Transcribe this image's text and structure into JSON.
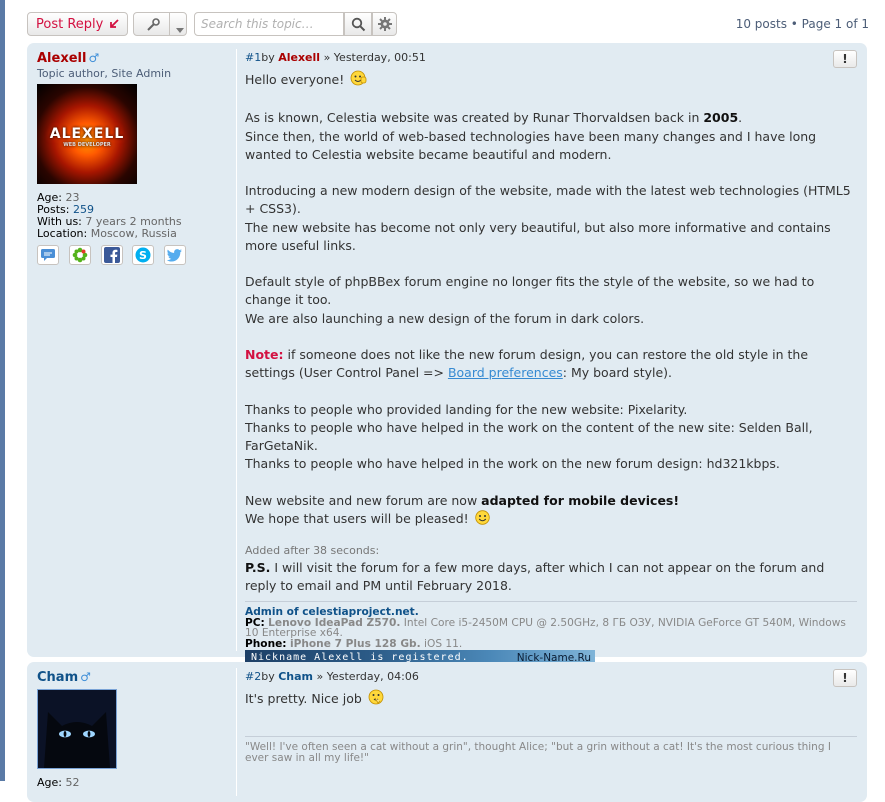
{
  "toolbar": {
    "post_reply_label": "Post Reply",
    "search_placeholder": "Search this topic…",
    "pagination_text": "10 posts • Page ",
    "pagination_current": "1",
    "pagination_of": " of ",
    "pagination_total": "1"
  },
  "posts": [
    {
      "author": "Alexell",
      "gender_symbol": "♂",
      "rank": "Topic author, Site Admin",
      "avatar_logo": "ALEXELL",
      "avatar_sub": "WEB DEVELOPER",
      "age_label": "Age:",
      "age": "23",
      "posts_label": "Posts:",
      "posts": "259",
      "with_us_label": "With us:",
      "with_us": "7 years 2 months",
      "location_label": "Location:",
      "location": "Moscow, Russia",
      "number": "#1",
      "by": "by",
      "date": "» Yesterday, 00:51",
      "report": "!",
      "p1": "Hello everyone!",
      "p2a": "As is known, Celestia website was created by Runar Thorvaldsen back in ",
      "p2b": "2005",
      "p2c": ".",
      "p3": "Since then, the world of web-based technologies have been many changes and I have long wanted to Celestia website became beautiful and modern.",
      "p4": "Introducing a new modern design of the website, made with the latest web technologies (HTML5 + CSS3).",
      "p5": "The new website has become not only very beautiful, but also more informative and contains more useful links.",
      "p6": "Default style of phpBBex forum engine no longer fits the style of the website, so we had to change it too.",
      "p7": "We are also launching a new design of the forum in dark colors.",
      "note_label": "Note:",
      "note_text": " if someone does not like the new forum design, you can restore the old style in the settings (User Control Panel => ",
      "note_link": "Board preferences",
      "note_tail": ": My board style).",
      "p8": "Thanks to people who provided landing for the new website: Pixelarity.",
      "p9": "Thanks to people who have helped in the work on the content of the new site: Selden Ball, FarGetaNik.",
      "p10": "Thanks to people who have helped in the work on the new forum design: hd321kbps.",
      "p11a": "New website and new forum are now ",
      "p11b": "adapted for mobile devices!",
      "p12": "We hope that users will be pleased!",
      "added": "Added after 38 seconds:",
      "ps_label": "P.S.",
      "ps_text": " I will visit the forum for a few more days, after which I can not appear on the forum and reply to email and PM until February 2018.",
      "sig_admin": "Admin of celestiaproject.net.",
      "sig_pc_label": "PC:",
      "sig_pc_model": "Lenovo IdeaPad Z570.",
      "sig_pc_spec": " Intel Core i5-2450M CPU @ 2.50GHz, 8 ГБ ОЗУ, NVIDIA GeForce GT 540M, Windows 10 Enterprise x64.",
      "sig_phone_label": "Phone:",
      "sig_phone_model": "iPhone 7 Plus 128 Gb.",
      "sig_phone_os": " iOS 11.",
      "nick_left": "Nickname Alexell is registered.",
      "nick_right": "Nick-Name.Ru"
    },
    {
      "author": "Cham",
      "gender_symbol": "♂",
      "age_label": "Age:",
      "age": "52",
      "number": "#2",
      "by": "by",
      "date": "» Yesterday, 04:06",
      "report": "!",
      "text": "It's pretty. Nice job",
      "signature": "\"Well! I've often seen a cat without a grin\", thought Alice; \"but a grin without a cat! It's the most curious thing I ever saw in all my life!\""
    }
  ],
  "colors": {
    "post_bg": "#e1ebf2",
    "accent_red": "#d31141",
    "admin_red": "#aa0000",
    "link_blue": "#105289"
  }
}
